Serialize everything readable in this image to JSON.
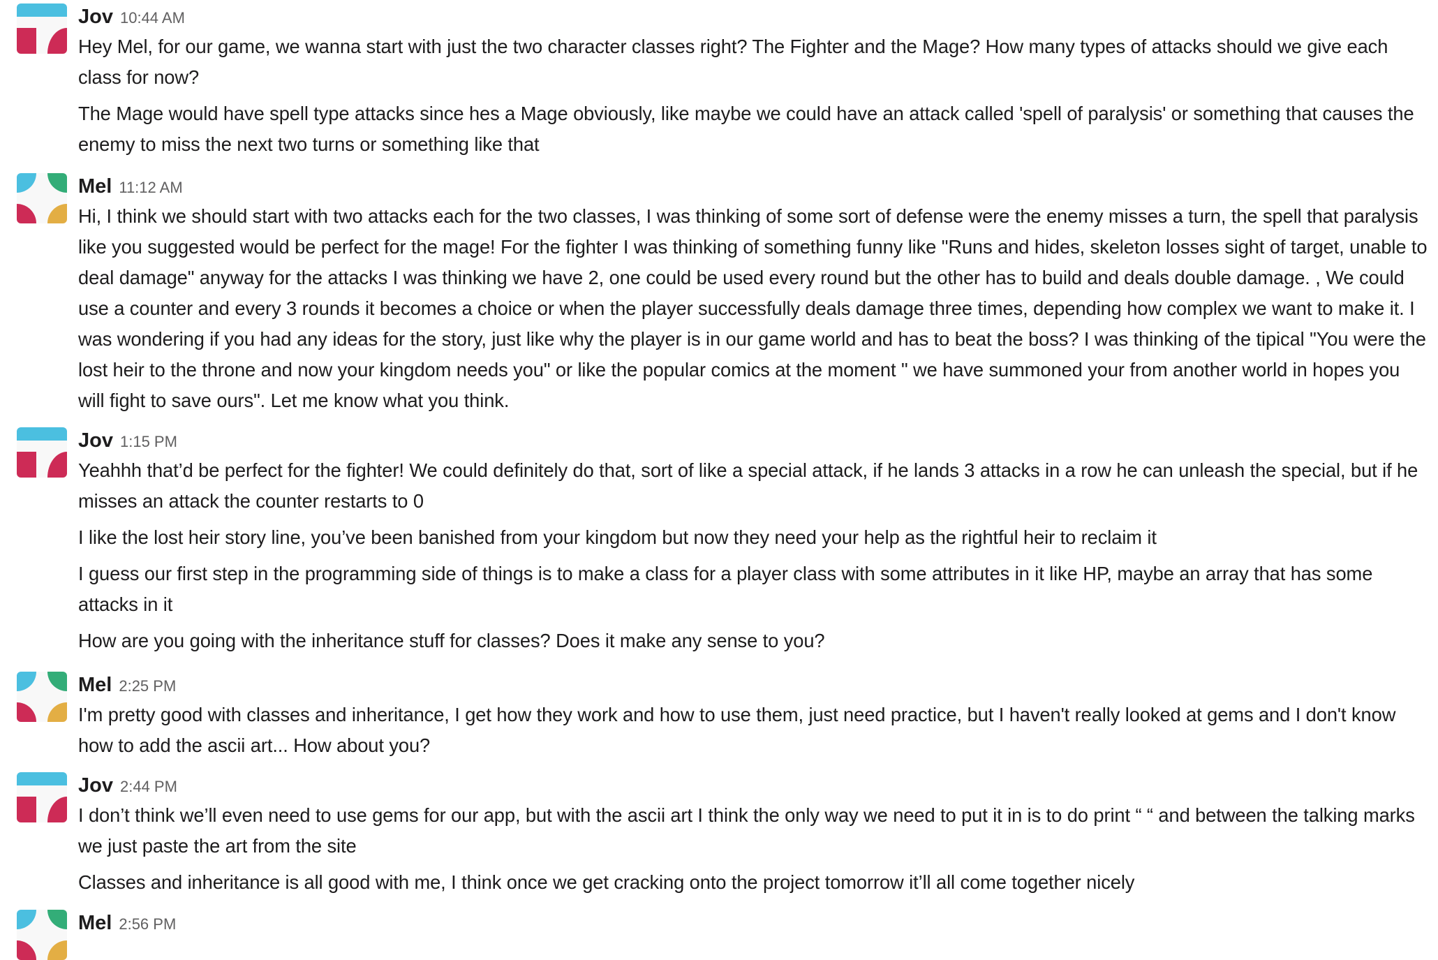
{
  "colors": {
    "cyan": "#4bbfe0",
    "green": "#33ad78",
    "red": "#cd2b56",
    "yellow": "#e3ae44"
  },
  "messages": [
    {
      "author": "Jov",
      "time": "10:44 AM",
      "avatar": "jov-avatar",
      "paragraphs": [
        "Hey Mel, for our game, we wanna start with just the two character classes right? The Fighter and the Mage?   How many types of attacks should we give each class for now?",
        "The Mage would have spell type attacks since hes a Mage obviously, like maybe we could have an attack called 'spell of paralysis' or something that causes the enemy to miss the next two turns or something like that"
      ]
    },
    {
      "author": "Mel",
      "time": "11:12 AM",
      "avatar": "mel-avatar",
      "paragraphs": [
        "Hi, I think we should start with two attacks each for the two classes, I was thinking of some sort of defense were the enemy misses a turn, the spell that paralysis like you suggested would be perfect for the mage! For the fighter I was thinking of something funny like \"Runs and hides, skeleton losses sight of target, unable to deal damage\" anyway for the attacks I was thinking we have 2, one could be used every round but the other has to build and deals double damage. , We could use a counter and every 3 rounds it becomes a choice or when the player successfully deals damage three times, depending how complex we want to make it. I was wondering if you had any ideas for the story, just like why the player is in our game world and has to beat the boss? I was thinking of the tipical \"You were the lost heir to the throne and now your kingdom needs you\" or like the popular comics at the moment \" we have summoned your from another world in hopes you will fight to save ours\". Let me know what you think."
      ]
    },
    {
      "author": "Jov",
      "time": "1:15 PM",
      "avatar": "jov-avatar",
      "paragraphs": [
        "Yeahhh that’d be perfect for the fighter! We could definitely do that, sort of like a special attack, if he lands 3 attacks in a row he can unleash the special, but if he misses an attack the counter restarts to 0",
        "I like the lost heir story line, you’ve been banished from your kingdom but now they need your help as the rightful heir to reclaim it",
        "I guess our first step in the programming side of things is to make a class for a player class with some attributes in it like HP, maybe an array that has some attacks in it",
        "How are you going with the inheritance stuff for classes? Does it make any sense to you?"
      ]
    },
    {
      "author": "Mel",
      "time": "2:25 PM",
      "avatar": "mel-avatar",
      "paragraphs": [
        "I'm pretty good with classes and inheritance, I get how they work and how to use them, just need practice, but I haven't really looked at gems and I don't know how to add the ascii art... How about you?"
      ]
    },
    {
      "author": "Jov",
      "time": "2:44 PM",
      "avatar": "jov-avatar",
      "paragraphs": [
        "I don’t think we’ll even need to use gems for our app, but with the ascii art I think the only way we need to put it in is to do print “ “ and between the talking marks we just paste the art from the site",
        "Classes and inheritance is all good with me, I think once we get cracking onto the project tomorrow it’ll all come together nicely"
      ]
    },
    {
      "author": "Mel",
      "time": "2:56 PM",
      "avatar": "mel-avatar",
      "paragraphs": []
    }
  ]
}
